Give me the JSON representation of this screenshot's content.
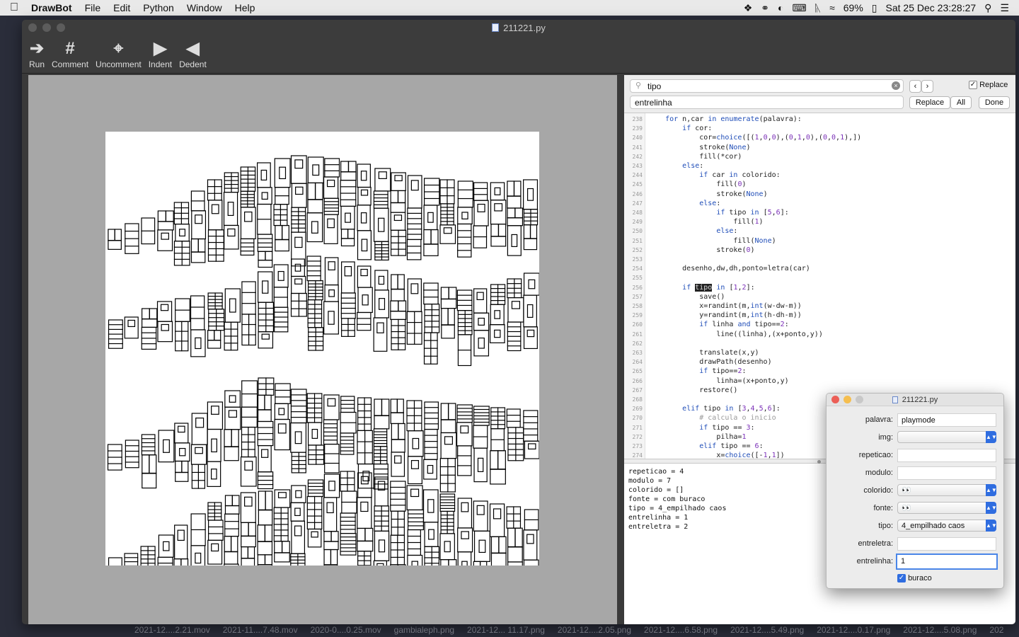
{
  "menubar": {
    "app": "DrawBot",
    "items": [
      "File",
      "Edit",
      "Python",
      "Window",
      "Help"
    ],
    "battery": "69%",
    "clock": "Sat 25 Dec  23:28:27"
  },
  "window": {
    "title": "211221.py",
    "toolbar": [
      "Run",
      "Comment",
      "Uncomment",
      "Indent",
      "Dedent"
    ]
  },
  "find": {
    "search": "tipo",
    "replace_field": "entrelinha",
    "replace_check": "Replace",
    "btn_replace": "Replace",
    "btn_all": "All",
    "btn_done": "Done"
  },
  "code_lines": [
    {
      "n": "238",
      "t": "    for n,car in enumerate(palavra):"
    },
    {
      "n": "239",
      "t": "        if cor:"
    },
    {
      "n": "240",
      "t": "            cor=choice([(1,0,0),(0,1,0),(0,0,1),])"
    },
    {
      "n": "241",
      "t": "            stroke(None)"
    },
    {
      "n": "242",
      "t": "            fill(*cor)"
    },
    {
      "n": "243",
      "t": "        else:"
    },
    {
      "n": "244",
      "t": "            if car in colorido:"
    },
    {
      "n": "245",
      "t": "                fill(0)"
    },
    {
      "n": "246",
      "t": "                stroke(None)"
    },
    {
      "n": "247",
      "t": "            else:"
    },
    {
      "n": "248",
      "t": "                if tipo in [5,6]:"
    },
    {
      "n": "249",
      "t": "                    fill(1)"
    },
    {
      "n": "250",
      "t": "                else:"
    },
    {
      "n": "251",
      "t": "                    fill(None)"
    },
    {
      "n": "252",
      "t": "                stroke(0)"
    },
    {
      "n": "253",
      "t": ""
    },
    {
      "n": "254",
      "t": "        desenho,dw,dh,ponto=letra(car)"
    },
    {
      "n": "255",
      "t": ""
    },
    {
      "n": "256",
      "t": "        if tipo in [1,2]:"
    },
    {
      "n": "257",
      "t": "            save()"
    },
    {
      "n": "258",
      "t": "            x=randint(m,int(w-dw-m))"
    },
    {
      "n": "259",
      "t": "            y=randint(m,int(h-dh-m))"
    },
    {
      "n": "260",
      "t": "            if linha and tipo==2:"
    },
    {
      "n": "261",
      "t": "                line((linha),(x+ponto,y))"
    },
    {
      "n": "262",
      "t": ""
    },
    {
      "n": "263",
      "t": "            translate(x,y)"
    },
    {
      "n": "264",
      "t": "            drawPath(desenho)"
    },
    {
      "n": "265",
      "t": "            if tipo==2:"
    },
    {
      "n": "266",
      "t": "                linha=(x+ponto,y)"
    },
    {
      "n": "267",
      "t": "            restore()"
    },
    {
      "n": "268",
      "t": ""
    },
    {
      "n": "269",
      "t": "        elif tipo in [3,4,5,6]:"
    },
    {
      "n": "270",
      "t": "            # calcula o inicio"
    },
    {
      "n": "271",
      "t": "            if tipo == 3:"
    },
    {
      "n": "272",
      "t": "                pilha=1"
    },
    {
      "n": "273",
      "t": "            elif tipo == 6:"
    },
    {
      "n": "274",
      "t": "                x=choice([-1,1])"
    }
  ],
  "output": "repeticao = 4\nmodulo = 7\ncolorido = []\nfonte = com buraco\ntipo = 4_empilhado caos\nentrelinha = 1\nentreletra = 2",
  "vars_panel": {
    "title": "211221.py",
    "labels": {
      "palavra": "palavra:",
      "img": "img:",
      "repeticao": "repeticao:",
      "modulo": "modulo:",
      "colorido": "colorido:",
      "fonte": "fonte:",
      "tipo": "tipo:",
      "entreletra": "entreletra:",
      "entrelinha": "entrelinha:"
    },
    "palavra_value": "playmode",
    "colorido_value": "👀",
    "fonte_value": "👀",
    "tipo_value": "4_empilhado caos",
    "entrelinha_value": "1",
    "buraco_label": "buraco",
    "buraco_checked": true
  },
  "desktop_files": [
    "2021-12....2.21.mov",
    "2021-11....7.48.mov",
    "2020-0....0.25.mov",
    "gambialeph.png",
    "2021-12... 11.17.png",
    "2021-12....2.05.png",
    "2021-12....6.58.png",
    "2021-12....5.49.png",
    "2021-12....0.17.png",
    "2021-12....5.08.png",
    "202"
  ],
  "colors": {
    "accent": "#2f6de0",
    "selection": "#4a86e8",
    "canvas_bg": "#a7a7a7",
    "keyword": "#1f4db8"
  }
}
